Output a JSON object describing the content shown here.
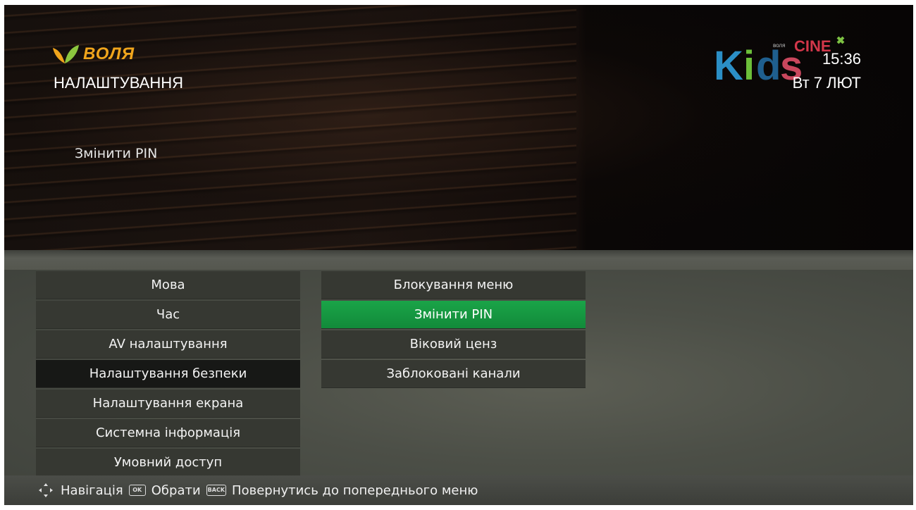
{
  "header": {
    "brand_name": "ВОЛЯ",
    "page_title": "НАЛАШТУВАННЯ",
    "preview_label": "Змінити PIN",
    "clock": "15:36",
    "date": "Вт 7 ЛЮТ"
  },
  "channel_logo": {
    "icon": "kids-cine-channel-logo",
    "text_main": "Kids",
    "text_top": "CINE",
    "text_small": "воля"
  },
  "left_menu": {
    "items": [
      {
        "label": "Мова"
      },
      {
        "label": "Час"
      },
      {
        "label": "AV налаштування"
      },
      {
        "label": "Налаштування безпеки"
      },
      {
        "label": "Налаштування екрана"
      },
      {
        "label": "Системна інформація"
      },
      {
        "label": "Умовний доступ"
      }
    ],
    "active_index": 3
  },
  "right_menu": {
    "items": [
      {
        "label": "Блокування меню"
      },
      {
        "label": "Змінити PIN"
      },
      {
        "label": "Віковий ценз"
      },
      {
        "label": "Заблоковані канали"
      }
    ],
    "selected_index": 1
  },
  "footer": {
    "navigation_label": "Навігація",
    "ok_key": "OK",
    "select_label": "Обрати",
    "back_key": "BACK",
    "back_label": "Повернутись до попереднього меню"
  },
  "colors": {
    "brand_orange": "#f0a51c",
    "selected_green": "#1aa448",
    "menu_item_bg": "#363832",
    "active_item_bg": "#171816"
  }
}
